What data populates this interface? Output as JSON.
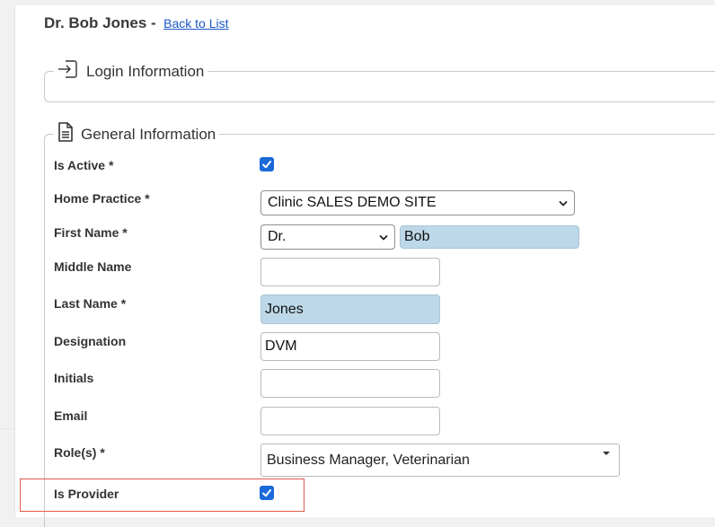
{
  "header": {
    "title": "Dr. Bob Jones -",
    "back_link": "Back to List"
  },
  "sections": {
    "login": {
      "title": "Login Information",
      "icon": "sign-in-icon"
    },
    "general": {
      "title": "General Information",
      "icon": "document-icon"
    }
  },
  "form": {
    "is_active": {
      "label": "Is Active *",
      "checked": true
    },
    "home_practice": {
      "label": "Home Practice *",
      "value": "Clinic SALES DEMO SITE"
    },
    "first_name": {
      "label": "First Name *",
      "prefix": "Dr.",
      "value": "Bob"
    },
    "middle_name": {
      "label": "Middle Name",
      "value": ""
    },
    "last_name": {
      "label": "Last Name *",
      "value": "Jones"
    },
    "designation": {
      "label": "Designation",
      "value": "DVM"
    },
    "initials": {
      "label": "Initials",
      "value": ""
    },
    "email": {
      "label": "Email",
      "value": ""
    },
    "roles": {
      "label": "Role(s) *",
      "value": "Business Manager, Veterinarian"
    },
    "is_provider": {
      "label": "Is Provider",
      "checked": true
    }
  },
  "colors": {
    "accent": "#1b6ad8",
    "autofill": "#bdd8e8",
    "highlight": "#e05a4a",
    "link": "#1a55c9"
  }
}
